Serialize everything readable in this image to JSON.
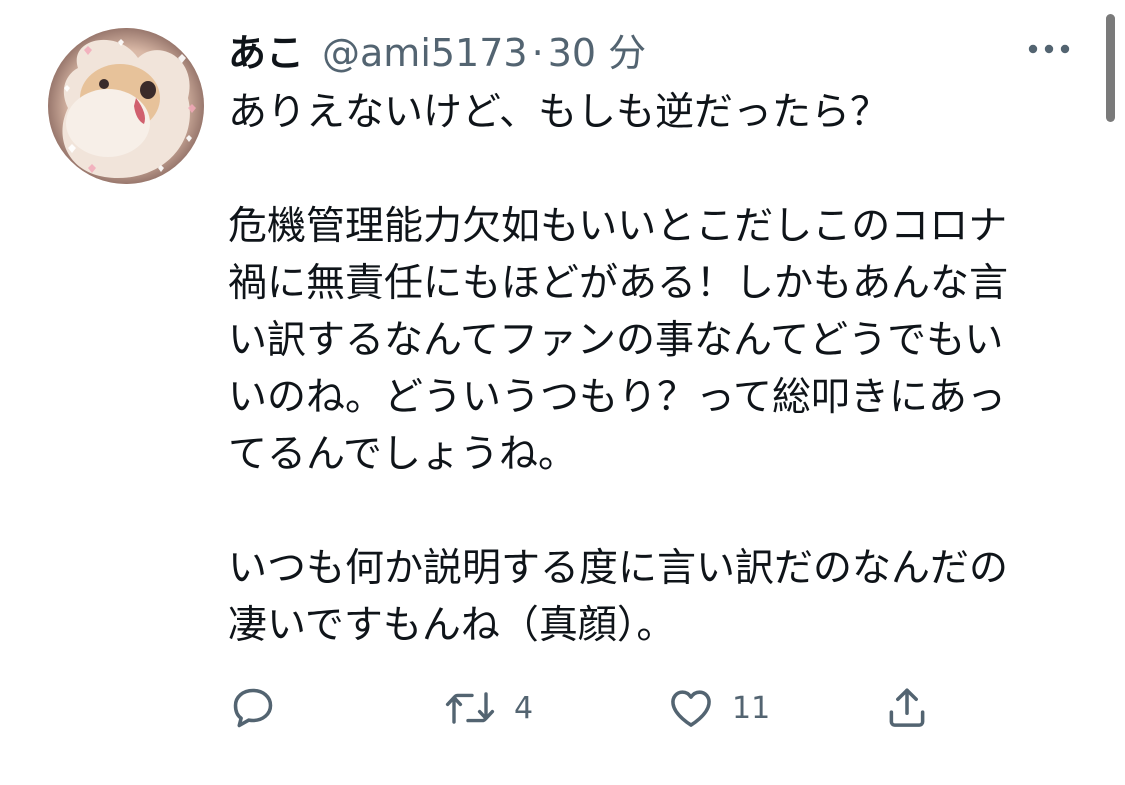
{
  "tweet": {
    "display_name": "あこ",
    "handle": "@ami5173",
    "separator": "·",
    "time": "30 分",
    "paragraphs": [
      "ありえないけど、もしも逆だったら？",
      "危機管理能力欠如もいいとこだしこのコロナ\n禍に無責任にもほどがある！しかもあんな言\nい訳するなんてファンの事なんてどうでもい\nいのね。どういうつもり？って総叩きにあっ\nてるんでしょうね。",
      "いつも何か説明する度に言い訳だのなんだの\n凄いですもんね（真顔）。"
    ],
    "retweet_count": "4",
    "like_count": "11"
  },
  "icons": {
    "avatar": "avatar-dog-photo",
    "more": "more-horizontal-icon",
    "reply": "reply-bubble-icon",
    "retweet": "retweet-arrows-icon",
    "like": "heart-outline-icon",
    "share": "share-upload-icon"
  },
  "colors": {
    "text": "#0f1419",
    "secondary": "#536471",
    "background": "#ffffff"
  }
}
